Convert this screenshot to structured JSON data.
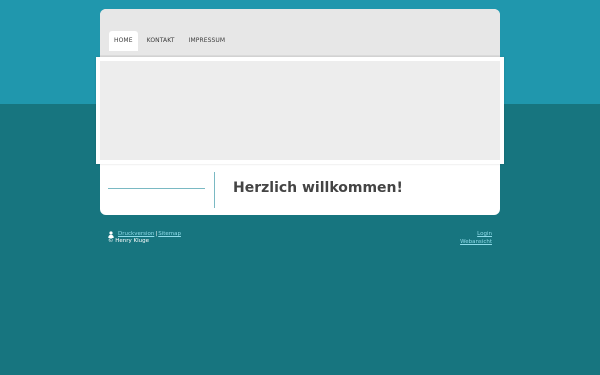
{
  "nav": {
    "items": [
      {
        "label": "HOME",
        "active": true
      },
      {
        "label": "KONTAKT",
        "active": false
      },
      {
        "label": "IMPRESSUM",
        "active": false
      }
    ]
  },
  "main": {
    "heading": "Herzlich willkommen!"
  },
  "footer": {
    "print_link": "Druckversion",
    "separator": "|",
    "sitemap_link": "Sitemap",
    "copyright": "© Henry Kluge",
    "login_link": "Login",
    "webansicht_link": "Webansicht"
  },
  "colors": {
    "top_band": "#2097ad",
    "background": "#17757f",
    "link": "#8fdcea"
  },
  "icons": {
    "footer_user": "user-icon"
  }
}
